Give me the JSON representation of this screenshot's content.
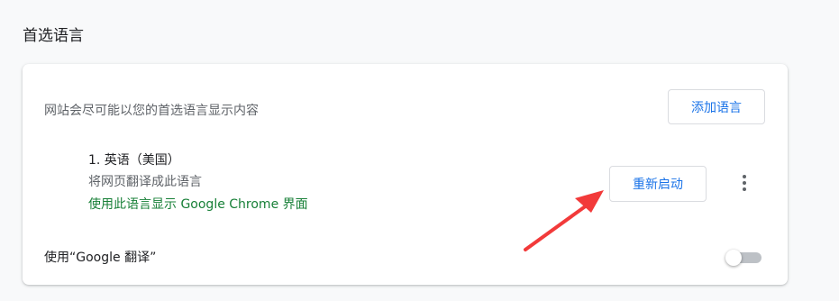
{
  "section": {
    "title": "首选语言"
  },
  "languages_card": {
    "description": "网站会尽可能以您的首选语言显示内容",
    "add_button_label": "添加语言",
    "language": {
      "name": "1. 英语（美国）",
      "translate_text": "将网页翻译成此语言",
      "display_text": "使用此语言显示 Google Chrome 界面",
      "restart_button_label": "重新启动",
      "more_icon": "more-vert-icon"
    },
    "translate_toggle": {
      "label": "使用“Google 翻译”",
      "enabled": false
    }
  },
  "annotation": {
    "arrow_color": "#f23a3a"
  },
  "colors": {
    "accent": "#1a73e8",
    "display_text": "#188038",
    "toggle_off_track": "#bdc1c6"
  }
}
